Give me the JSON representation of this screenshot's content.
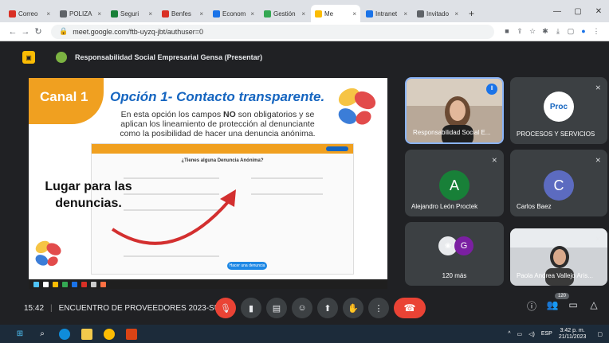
{
  "browser": {
    "tabs": [
      {
        "label": "Correo",
        "color": "#d93025"
      },
      {
        "label": "POLIZA",
        "color": "#5f6368"
      },
      {
        "label": "Seguri",
        "color": "#188038"
      },
      {
        "label": "Benfes",
        "color": "#d93025"
      },
      {
        "label": "Econom",
        "color": "#1a73e8"
      },
      {
        "label": "Gestión",
        "color": "#34a853"
      },
      {
        "label": "Me",
        "color": "#fbbc04",
        "active": true
      },
      {
        "label": "Intranet",
        "color": "#1a73e8"
      },
      {
        "label": "Invitado",
        "color": "#5f6368"
      }
    ],
    "new_tab": "+",
    "url": "meet.google.com/ftb-uyzq-jbt/authuser=0"
  },
  "meet": {
    "presenter_label": "Responsabilidad Social Empresarial Gensa (Presentar)",
    "meeting_time": "15:42",
    "meeting_name": "ENCUENTRO DE PROVEEDORES 2023-SU...",
    "participant_count": "120"
  },
  "slide": {
    "canal": "Canal 1",
    "title": "Opción 1- Contacto transparente.",
    "body_pre": "En esta opción los campos ",
    "body_bold": "NO",
    "body_post": " son obligatorios y se aplican los lineamiento de protección al denunciante como la posibilidad de hacer una denuncia anónima.",
    "form_question": "¿Tienes alguna Denuncia Anónima?",
    "form_button": "Hacer una denuncia",
    "lugar": "Lugar para las denuncias."
  },
  "participants": {
    "p1": {
      "name": "Responsabilidad Social E..."
    },
    "p2": {
      "name": "PROCESOS Y SERVICIOS",
      "logo": "Proc"
    },
    "p3": {
      "name": "Alejandro León Proctek",
      "initial": "A",
      "color": "#188038"
    },
    "p4": {
      "name": "Carlos Baez",
      "initial": "C",
      "color": "#5c6bc0"
    },
    "p5": {
      "name": "120 más",
      "initial": "G",
      "color": "#7b1fa2"
    },
    "p6": {
      "name": "Paola Andrea Vallejo Aris..."
    }
  },
  "taskbar": {
    "lang": "ESP",
    "time": "3:42 p. m.",
    "date": "21/11/2023"
  }
}
